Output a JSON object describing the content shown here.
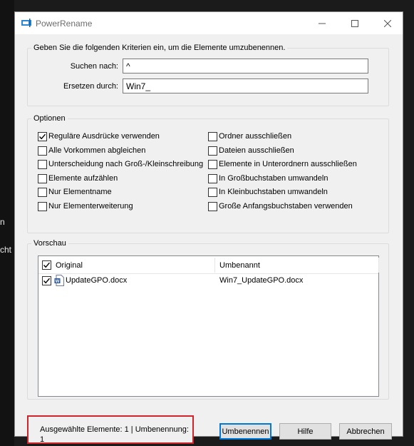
{
  "window": {
    "title": "PowerRename"
  },
  "background": {
    "fragment1": "n",
    "fragment2": "cht"
  },
  "criteria": {
    "legend": "Geben Sie die folgenden Kriterien ein, um die Elemente umzubenennen.",
    "search_label": "Suchen nach:",
    "search_value": "^",
    "replace_label": "Ersetzen durch:",
    "replace_value": "Win7_"
  },
  "options": {
    "legend": "Optionen",
    "left": [
      {
        "label": "Reguläre Ausdrücke verwenden",
        "checked": true
      },
      {
        "label": "Alle Vorkommen abgleichen",
        "checked": false
      },
      {
        "label": "Unterscheidung nach Groß-/Kleinschreibung",
        "checked": false
      },
      {
        "label": "Elemente aufzählen",
        "checked": false
      },
      {
        "label": "Nur Elementname",
        "checked": false
      },
      {
        "label": "Nur Elementerweiterung",
        "checked": false
      }
    ],
    "right": [
      {
        "label": "Ordner ausschließen",
        "checked": false
      },
      {
        "label": "Dateien ausschließen",
        "checked": false
      },
      {
        "label": "Elemente in Unterordnern ausschließen",
        "checked": false
      },
      {
        "label": "In Großbuchstaben umwandeln",
        "checked": false
      },
      {
        "label": "In Kleinbuchstaben umwandeln",
        "checked": false
      },
      {
        "label": "Große Anfangsbuchstaben verwenden",
        "checked": false
      }
    ]
  },
  "preview": {
    "legend": "Vorschau",
    "columns": {
      "original": "Original",
      "renamed": "Umbenannt"
    },
    "header_checked": true,
    "rows": [
      {
        "checked": true,
        "icon": "word-document-icon",
        "original": "UpdateGPO.docx",
        "renamed": "Win7_UpdateGPO.docx"
      }
    ]
  },
  "status": {
    "text": "Ausgewählte Elemente: 1 | Umbenennung: 1"
  },
  "buttons": {
    "rename": "Umbenennen",
    "help": "Hilfe",
    "cancel": "Abbrechen"
  },
  "colors": {
    "highlight_border": "#d0242b",
    "accent": "#0078d7"
  }
}
